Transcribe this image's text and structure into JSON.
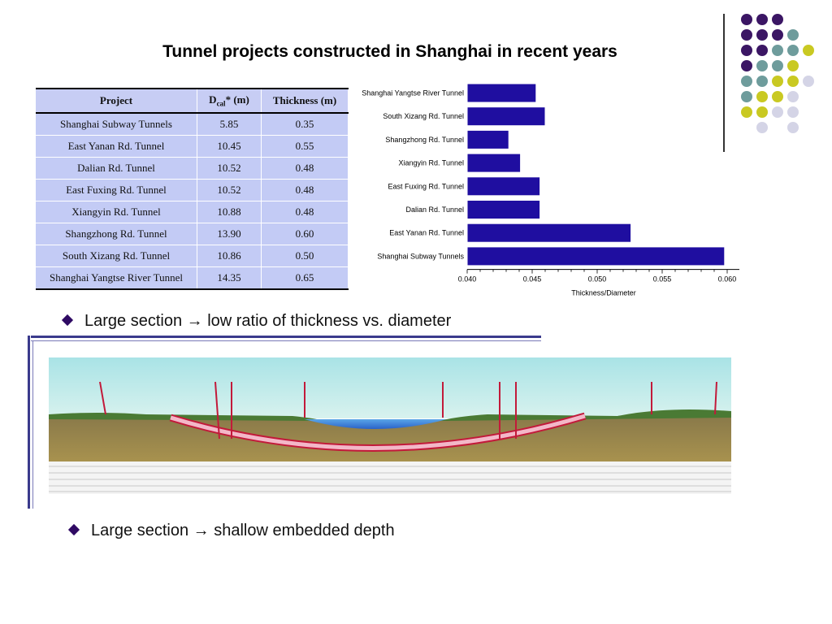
{
  "title": "Tunnel projects constructed in Shanghai in recent years",
  "table": {
    "headers": {
      "project": "Project",
      "dcal_main": "D",
      "dcal_sub": "cal",
      "dcal_rest": "* (m)",
      "thickness": "Thickness (m)"
    },
    "rows": [
      {
        "project": "Shanghai Subway Tunnels",
        "d": "5.85",
        "t": "0.35"
      },
      {
        "project": "East Yanan Rd. Tunnel",
        "d": "10.45",
        "t": "0.55"
      },
      {
        "project": "Dalian Rd. Tunnel",
        "d": "10.52",
        "t": "0.48"
      },
      {
        "project": "East Fuxing Rd. Tunnel",
        "d": "10.52",
        "t": "0.48"
      },
      {
        "project": "Xiangyin Rd. Tunnel",
        "d": "10.88",
        "t": "0.48"
      },
      {
        "project": "Shangzhong Rd. Tunnel",
        "d": "13.90",
        "t": "0.60"
      },
      {
        "project": "South Xizang Rd. Tunnel",
        "d": "10.86",
        "t": "0.50"
      },
      {
        "project": "Shanghai Yangtse River Tunnel",
        "d": "14.35",
        "t": "0.65"
      }
    ]
  },
  "chart_data": {
    "type": "bar",
    "orientation": "horizontal",
    "categories": [
      "Shanghai Yangtse River Tunnel",
      "South Xizang Rd. Tunnel",
      "Shangzhong Rd. Tunnel",
      "Xiangyin Rd. Tunnel",
      "East Fuxing Rd. Tunnel",
      "Dalian Rd. Tunnel",
      "East Yanan Rd. Tunnel",
      "Shanghai Subway Tunnels"
    ],
    "values": [
      0.0453,
      0.046,
      0.0432,
      0.0441,
      0.0456,
      0.0456,
      0.0526,
      0.0598
    ],
    "xlabel": "Thickness/Diameter",
    "xlim": [
      0.04,
      0.06
    ],
    "xticks": [
      "0.040",
      "0.045",
      "0.050",
      "0.055",
      "0.060"
    ],
    "bar_color": "#1f0ea0",
    "grid": false
  },
  "bullets": [
    "Large section → low ratio of thickness vs. diameter",
    "Large section → shallow embedded depth"
  ],
  "colors": {
    "purple": "#3b1664",
    "teal": "#6e9c9c",
    "olive": "#c9c922",
    "lavender": "#d4d4e6",
    "bullet": "#2f0a63"
  },
  "images": {
    "profile": "tunnel longitudinal profile drawing"
  }
}
